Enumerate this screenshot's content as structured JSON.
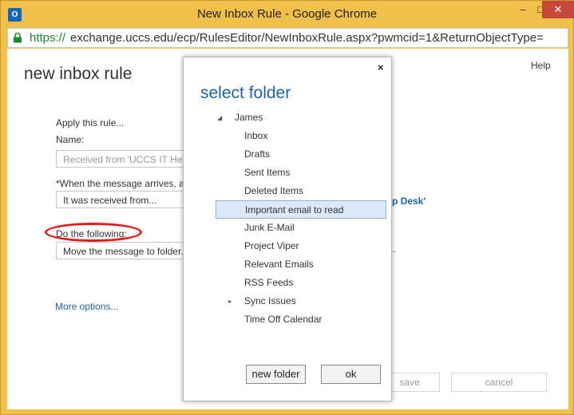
{
  "window": {
    "title": "New Inbox Rule - Google Chrome",
    "app_icon": "O",
    "min_glyph": "–",
    "max_glyph": "□",
    "close_glyph": "✕"
  },
  "address_bar": {
    "scheme": "https://",
    "rest": "exchange.uccs.edu/ecp/RulesEditor/NewInboxRule.aspx?pwmcid=1&ReturnObjectType="
  },
  "page": {
    "title": "new inbox rule",
    "help": "Help",
    "apply_label": "Apply this rule...",
    "name_label": "Name:",
    "name_value": "Received from 'UCCS IT Help",
    "when_label": "*When the message arrives, and",
    "when_value": "It was received from...",
    "when_link": "p Desk'",
    "do_label": "Do the following:",
    "do_value": "Move the message to folder...",
    "do_trailing": "..",
    "more_options": "More options...",
    "save": "save",
    "cancel": "cancel"
  },
  "dialog": {
    "title": "select folder",
    "close": "×",
    "root": "James",
    "folders": [
      {
        "label": "Inbox"
      },
      {
        "label": "Drafts"
      },
      {
        "label": "Sent Items"
      },
      {
        "label": "Deleted Items"
      },
      {
        "label": "Important email to read"
      },
      {
        "label": "Junk E-Mail"
      },
      {
        "label": "Project Viper"
      },
      {
        "label": "Relevant Emails"
      },
      {
        "label": "RSS Feeds"
      },
      {
        "label": "Sync Issues"
      },
      {
        "label": "Time Off Calendar"
      }
    ],
    "selected_index": 4,
    "expandable_index": 9,
    "new_folder": "new folder",
    "ok": "ok"
  },
  "colors": {
    "accent": "#1a64b0",
    "window_frame": "#f0c04a",
    "annotation": "#e11d1d",
    "selection": "#dbe8f6"
  }
}
